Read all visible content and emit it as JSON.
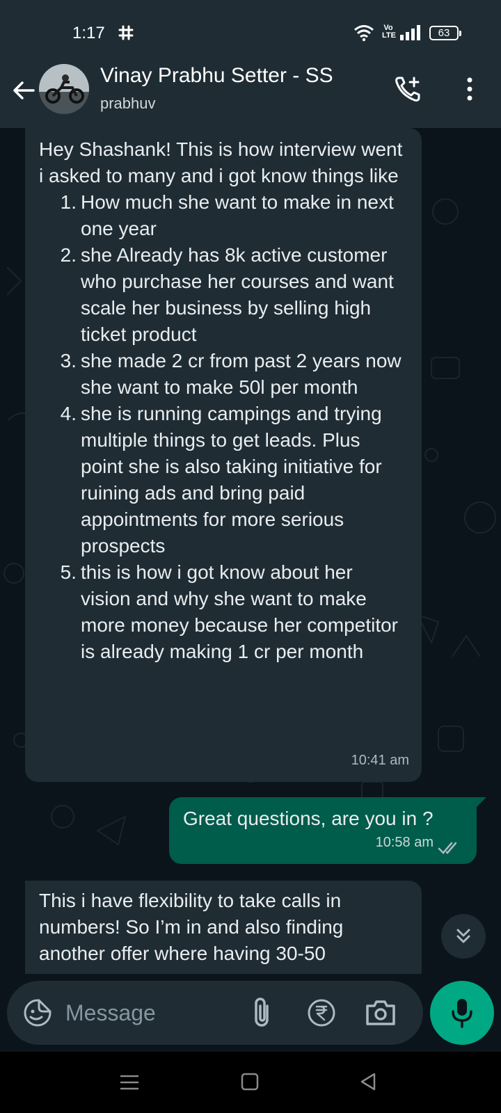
{
  "status_bar": {
    "time": "1:17",
    "volte": "Vo LTE",
    "battery": "63"
  },
  "header": {
    "contact_name": "Vinay Prabhu Setter - SS",
    "contact_sub": "prabhuv"
  },
  "messages": [
    {
      "direction": "incoming",
      "intro": "Hey Shashank! This is how interview went i asked to many and i got know things like",
      "list": [
        {
          "n": "1.",
          "text": "How much she want to make in next one year"
        },
        {
          "n": "2.",
          "text": "she Already has 8k active customer who purchase her courses and want scale her business by selling high ticket product"
        },
        {
          "n": "3.",
          "text": "she made 2 cr from past 2 years now she want to make 50l per month"
        },
        {
          "n": "4.",
          "text": "she is running campings and trying multiple things to get leads. Plus point she is also taking initiative for ruining ads and bring paid appointments for more serious prospects"
        },
        {
          "n": "5.",
          "text": "this is how i got know about her vision and why she want to make more money because her competitor is already making 1 cr per month"
        }
      ],
      "time": "10:41 am"
    },
    {
      "direction": "outgoing",
      "text": "Great questions, are you in ?",
      "time": "10:58 am",
      "status": "read"
    },
    {
      "direction": "incoming",
      "text": "This i have flexibility to take calls in numbers! So I’m in and also finding another offer where having 30-50"
    }
  ],
  "composer": {
    "placeholder": "Message"
  },
  "colors": {
    "header_bg": "#1f2c34",
    "chat_bg": "#0b141a",
    "incoming_bubble": "#1f2c34",
    "outgoing_bubble": "#005c4b",
    "accent": "#00a884"
  }
}
